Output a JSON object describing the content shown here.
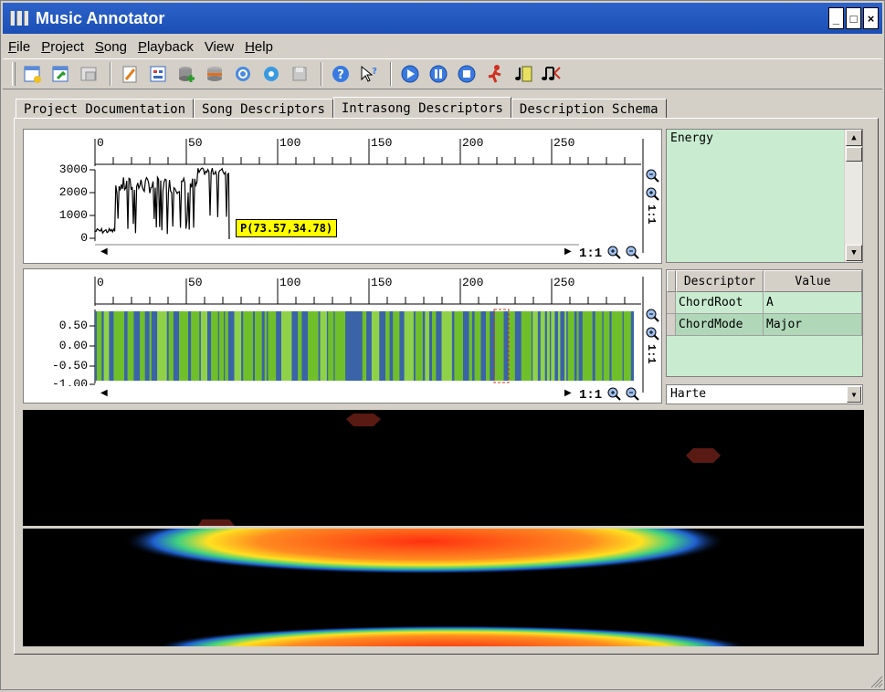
{
  "window": {
    "title": "Music Annotator",
    "controls": [
      "_",
      "□",
      "×"
    ]
  },
  "menu": [
    {
      "label": "File",
      "accel": "F",
      "rest": "ile"
    },
    {
      "label": "Project",
      "accel": "P",
      "rest": "roject"
    },
    {
      "label": "Song",
      "accel": "S",
      "rest": "ong"
    },
    {
      "label": "Playback",
      "accel": "P",
      "rest": "layback"
    },
    {
      "label": "View",
      "accel": "",
      "rest": "View"
    },
    {
      "label": "Help",
      "accel": "H",
      "rest": "elp"
    }
  ],
  "toolbar": {
    "icons": [
      "new-project-icon",
      "open-project-icon",
      "close-project-icon",
      "edit-icon",
      "schema-icon",
      "add-database-icon",
      "database-icon",
      "refresh-icon",
      "settings-icon",
      "save-icon",
      "help-icon",
      "whats-this-icon",
      "play-icon",
      "pause-icon",
      "stop-icon",
      "run-extractor-icon",
      "song-frame-icon",
      "music-note-icon"
    ]
  },
  "tabs": [
    {
      "label": "Project Documentation",
      "active": false
    },
    {
      "label": "Song Descriptors",
      "active": false
    },
    {
      "label": "Intrasong Descriptors",
      "active": true
    },
    {
      "label": "Description Schema",
      "active": false
    }
  ],
  "energy_plot": {
    "x_ticks": [
      "0",
      "50",
      "100",
      "150",
      "200",
      "250"
    ],
    "y_ticks": [
      "3000",
      "2000",
      "1000",
      "0"
    ],
    "tooltip": "P(73.57,34.78)",
    "zoom": "1:1"
  },
  "waveform_plot": {
    "x_ticks": [
      "0",
      "50",
      "100",
      "150",
      "200",
      "250"
    ],
    "y_ticks": [
      "0.50",
      "0.00",
      "-0.50",
      "-1.00"
    ],
    "zoom": "1:1"
  },
  "side": {
    "descriptor_text": "Energy",
    "table": {
      "headers": [
        "Descriptor",
        "Value"
      ],
      "rows": [
        {
          "descriptor": "ChordRoot",
          "value": "A"
        },
        {
          "descriptor": "ChordMode",
          "value": "Major"
        }
      ]
    },
    "combo_value": "Harte"
  },
  "colors": {
    "titlebar": "#1b4fb5",
    "segment_green": "#6fbf2a",
    "wave_blue": "#3a63a8",
    "panel_bg": "#c9ecd0",
    "tooltip": "#ffff00"
  }
}
